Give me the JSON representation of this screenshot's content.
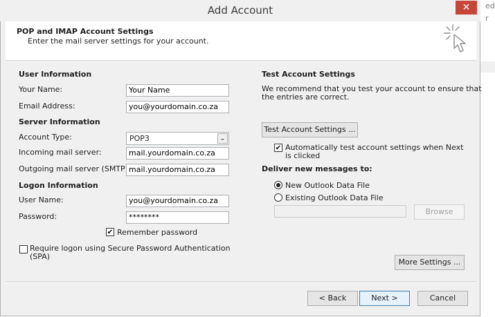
{
  "window": {
    "title": "Add Account",
    "close_glyph": "✕"
  },
  "background_app": {
    "text_line1": "ed/",
    "text_line2": "r"
  },
  "header": {
    "title": "POP and IMAP Account Settings",
    "subtitle": "Enter the mail server settings for your account.",
    "icon": "cursor-sparkle-icon"
  },
  "user_info": {
    "heading": "User Information",
    "name_label": "Your Name:",
    "name_value": "Your Name",
    "email_label": "Email Address:",
    "email_value": "you@yourdomain.co.za"
  },
  "server_info": {
    "heading": "Server Information",
    "account_type_label": "Account Type:",
    "account_type_value": "POP3",
    "incoming_label": "Incoming mail server:",
    "incoming_value": "mail.yourdomain.co.za",
    "outgoing_label": "Outgoing mail server (SMTP):",
    "outgoing_value": "mail.yourdomain.co.za"
  },
  "logon_info": {
    "heading": "Logon Information",
    "username_label": "User Name:",
    "username_value": "you@yourdomain.co.za",
    "password_label": "Password:",
    "password_value": "********",
    "remember_label": "Remember password",
    "remember_checked": true,
    "spa_label_line1": "Require logon using Secure Password Authentication",
    "spa_label_line2": "(SPA)",
    "spa_checked": false
  },
  "test_settings": {
    "heading": "Test Account Settings",
    "desc_line1": "We recommend that you test your account to ensure that",
    "desc_line2": "the entries are correct.",
    "test_button": "Test Account Settings ...",
    "auto_test_line1": "Automatically test account settings when Next",
    "auto_test_line2": "is clicked",
    "auto_test_checked": true
  },
  "delivery": {
    "heading": "Deliver new messages to:",
    "new_file_label": "New Outlook Data File",
    "existing_file_label": "Existing Outlook Data File",
    "selected": "new",
    "existing_path_value": "",
    "browse_button": "Browse"
  },
  "buttons": {
    "more_settings": "More Settings ...",
    "back": "< Back",
    "next": "Next >",
    "cancel": "Cancel"
  },
  "check_glyph": "✔",
  "select_arrow_glyph": "⌄"
}
